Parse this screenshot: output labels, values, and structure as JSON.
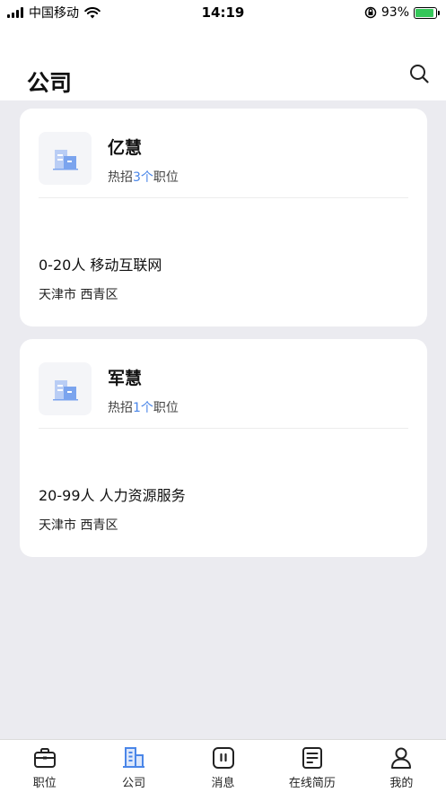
{
  "status_bar": {
    "carrier": "中国移动",
    "time": "14:19",
    "battery": "93%",
    "battery_level": 0.93
  },
  "header": {
    "title": "公司",
    "search_icon": "search-icon"
  },
  "companies": [
    {
      "name": "亿慧",
      "hiring_prefix": "热招",
      "hiring_count": "3个",
      "hiring_suffix": "职位",
      "size_industry": "0-20人 移动互联网",
      "location": "天津市 西青区",
      "logo_icon": "building-icon"
    },
    {
      "name": "军慧",
      "hiring_prefix": "热招",
      "hiring_count": "1个",
      "hiring_suffix": "职位",
      "size_industry": "20-99人 人力资源服务",
      "location": "天津市 西青区",
      "logo_icon": "building-icon"
    }
  ],
  "tabs": [
    {
      "label": "职位",
      "icon": "briefcase-icon",
      "active": false
    },
    {
      "label": "公司",
      "icon": "building-icon",
      "active": true
    },
    {
      "label": "消息",
      "icon": "message-icon",
      "active": false
    },
    {
      "label": "在线简历",
      "icon": "resume-icon",
      "active": false
    },
    {
      "label": "我的",
      "icon": "person-icon",
      "active": false
    }
  ],
  "colors": {
    "accent": "#4a86e8",
    "background": "#ebebf0",
    "card": "#ffffff"
  }
}
